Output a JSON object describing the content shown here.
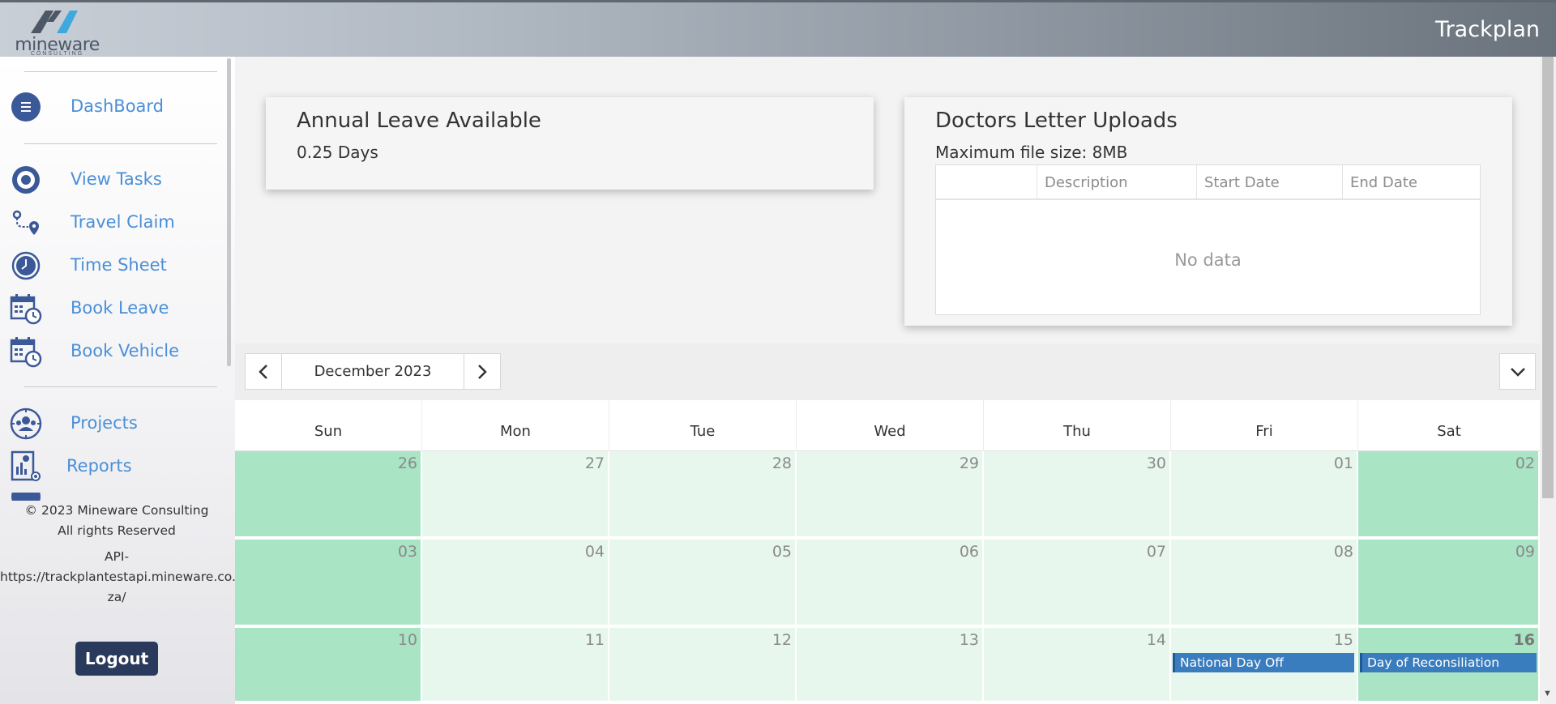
{
  "header": {
    "logo_text": "mineware",
    "logo_subtext": "CONSULTING",
    "app_title": "Trackplan"
  },
  "sidebar": {
    "items": [
      {
        "label": "DashBoard",
        "icon": "menu-circle-icon"
      },
      {
        "label": "View Tasks",
        "icon": "target-icon"
      },
      {
        "label": "Travel Claim",
        "icon": "route-icon"
      },
      {
        "label": "Time Sheet",
        "icon": "clock-icon"
      },
      {
        "label": "Book Leave",
        "icon": "calendar-clock-icon"
      },
      {
        "label": "Book Vehicle",
        "icon": "calendar-clock-icon"
      },
      {
        "label": "Projects",
        "icon": "team-icon"
      },
      {
        "label": "Reports",
        "icon": "report-icon"
      }
    ],
    "footer": {
      "copyright": "© 2023 Mineware Consulting",
      "rights": "All rights Reserved",
      "api_label": "API-",
      "api_url_line1": "https://trackplantestapi.mineware.co.",
      "api_url_line2": "za/",
      "logout_label": "Logout"
    }
  },
  "leave_card": {
    "title": "Annual Leave Available",
    "value": "0.25 Days"
  },
  "doc_card": {
    "title": "Doctors Letter Uploads",
    "max_size": "Maximum file size: 8MB",
    "columns": [
      "",
      "Description",
      "Start Date",
      "End Date"
    ],
    "empty_text": "No data"
  },
  "calendar": {
    "month_label": "December 2023",
    "day_names": [
      "Sun",
      "Mon",
      "Tue",
      "Wed",
      "Thu",
      "Fri",
      "Sat"
    ],
    "weeks": [
      [
        "26",
        "27",
        "28",
        "29",
        "30",
        "01",
        "02"
      ],
      [
        "03",
        "04",
        "05",
        "06",
        "07",
        "08",
        "09"
      ],
      [
        "10",
        "11",
        "12",
        "13",
        "14",
        "15",
        "16"
      ]
    ],
    "today": "16",
    "events": [
      {
        "day": "15",
        "title": "National Day Off"
      },
      {
        "day": "16",
        "title": "Day of Reconsiliation"
      }
    ],
    "colors": {
      "weekday": "#e8f7ee",
      "weekend": "#a9e4c5",
      "event": "#3a7dbf"
    }
  }
}
